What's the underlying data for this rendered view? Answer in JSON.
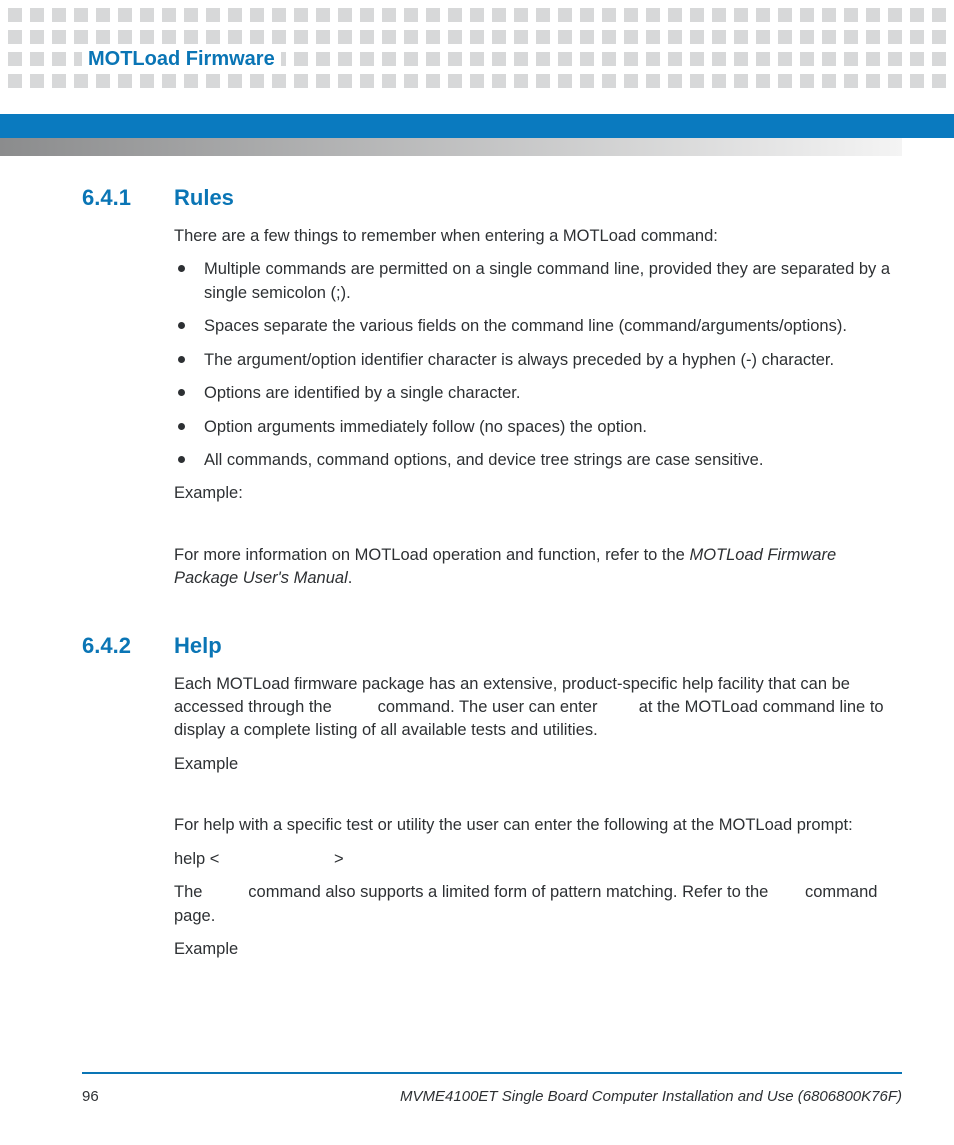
{
  "header": {
    "title": "MOTLoad Firmware"
  },
  "sections": [
    {
      "number": "6.4.1",
      "title": "Rules",
      "intro": "There are a few things to remember when entering a MOTLoad command:",
      "bullets": [
        "Multiple commands are permitted on a single command line, provided they are separated by a single semicolon (;).",
        "Spaces separate the various fields on the command line (command/arguments/options).",
        "The argument/option identifier character is always preceded by a hyphen (-) character.",
        "Options are identified by a single character.",
        "Option arguments immediately follow (no spaces) the option.",
        "All commands, command options, and device tree strings are case sensitive."
      ],
      "example_label": "Example:",
      "more_pre": "For more information on MOTLoad operation and function, refer to the ",
      "more_cite": "MOTLoad Firmware Package User's Manual",
      "more_post": "."
    },
    {
      "number": "6.4.2",
      "title": "Help",
      "p1a": "Each MOTLoad firmware package has an extensive, product-specific help facility that can be accessed through the ",
      "p1b": " command. The user can enter ",
      "p1c": " at the MOTLoad command line to display a complete listing of all available tests and utilities.",
      "example_label": "Example",
      "p2": "For help with a specific test or utility the user can enter the following at the MOTLoad prompt:",
      "help_line_pre": "help <",
      "help_line_post": ">",
      "p3a": "The ",
      "p3b": " command also supports a limited form of pattern matching. Refer to the ",
      "p3c": "command page.",
      "example2_label": "Example"
    }
  ],
  "footer": {
    "page": "96",
    "doc": "MVME4100ET Single Board Computer Installation and Use (6806800K76F)"
  }
}
